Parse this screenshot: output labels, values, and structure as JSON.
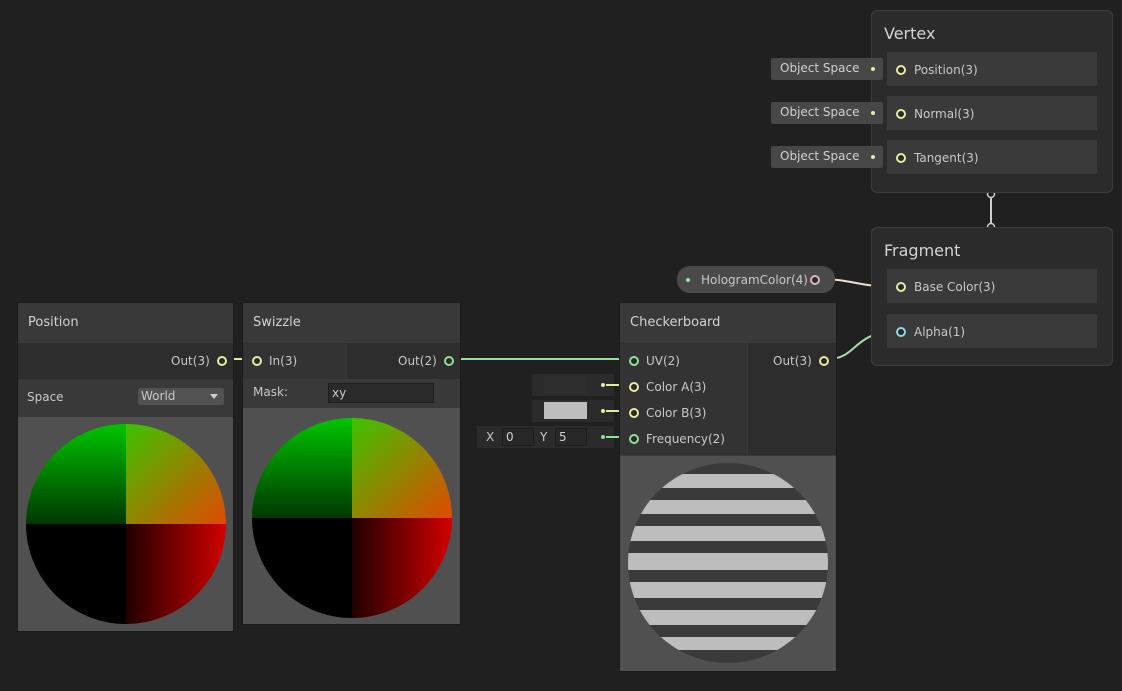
{
  "nodes": {
    "position": {
      "title": "Position",
      "out_label": "Out(3)",
      "space_label": "Space",
      "space_value": "World"
    },
    "swizzle": {
      "title": "Swizzle",
      "in_label": "In(3)",
      "out_label": "Out(2)",
      "mask_label": "Mask:",
      "mask_value": "xy"
    },
    "checkerboard": {
      "title": "Checkerboard",
      "inputs": [
        "UV(2)",
        "Color A(3)",
        "Color B(3)",
        "Frequency(2)"
      ],
      "out_label": "Out(3)",
      "color_a": "#2e2e2e",
      "color_b": "#bdbdbd",
      "freq_x_label": "X",
      "freq_x_value": "0",
      "freq_y_label": "Y",
      "freq_y_value": "5"
    },
    "property": {
      "label": "HologramColor(4)"
    }
  },
  "vertex": {
    "title": "Vertex",
    "slots": [
      {
        "label": "Position(3)",
        "context": "Object Space"
      },
      {
        "label": "Normal(3)",
        "context": "Object Space"
      },
      {
        "label": "Tangent(3)",
        "context": "Object Space"
      }
    ]
  },
  "fragment": {
    "title": "Fragment",
    "slots": [
      {
        "label": "Base Color(3)"
      },
      {
        "label": "Alpha(1)"
      }
    ]
  },
  "colors": {
    "canvas": "#202020",
    "vector3_port": "#e6eaa3",
    "vector2_port": "#8fe098",
    "vector1_port": "#8fd7e6",
    "vector4_port": "#d8b6c8"
  },
  "icons": [
    "dropdown-arrow-icon"
  ]
}
